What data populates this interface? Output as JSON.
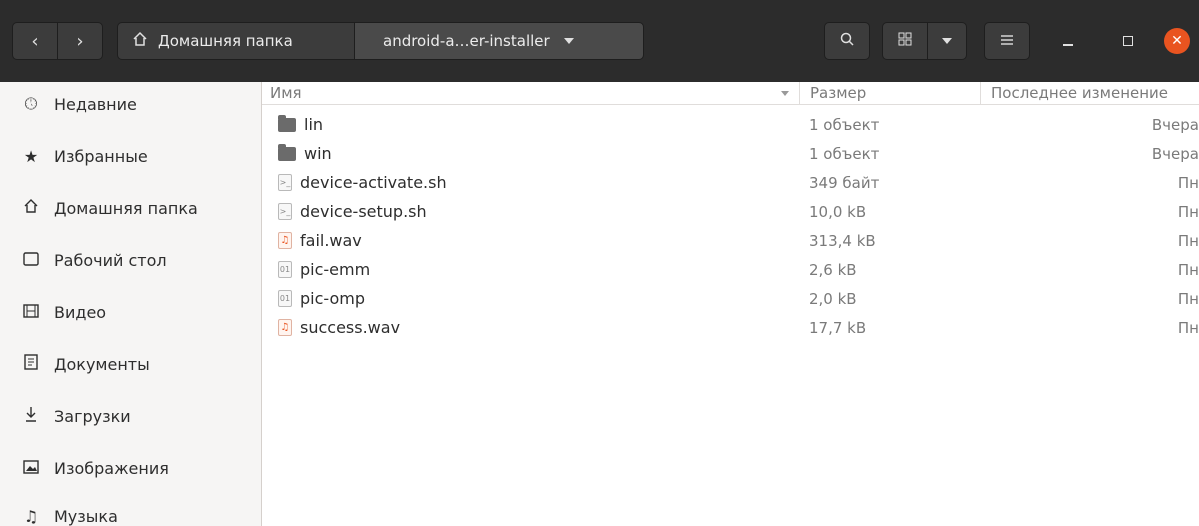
{
  "header": {
    "back_icon": "chevron-left-icon",
    "forward_icon": "chevron-right-icon",
    "home_icon": "home-icon",
    "home_label": "Домашняя папка",
    "current_folder": "android-a…er-installer",
    "search_icon": "search-icon",
    "view_icon": "grid-view-icon",
    "menu_icon": "hamburger-menu-icon",
    "minimize_icon": "minimize-icon",
    "maximize_icon": "maximize-icon",
    "close_icon": "close-icon",
    "close_color": "#e95420"
  },
  "sidebar": {
    "items": [
      {
        "label": "Недавние",
        "icon": "clock-icon"
      },
      {
        "label": "Избранные",
        "icon": "star-icon"
      },
      {
        "label": "Домашняя папка",
        "icon": "home-icon"
      },
      {
        "label": "Рабочий стол",
        "icon": "desktop-icon"
      },
      {
        "label": "Видео",
        "icon": "video-icon"
      },
      {
        "label": "Документы",
        "icon": "document-icon"
      },
      {
        "label": "Загрузки",
        "icon": "download-icon"
      },
      {
        "label": "Изображения",
        "icon": "image-icon"
      },
      {
        "label": "Музыка",
        "icon": "music-icon"
      }
    ]
  },
  "list": {
    "columns": {
      "name": "Имя",
      "size": "Размер",
      "modified": "Последнее изменение"
    },
    "rows": [
      {
        "name": "lin",
        "size": "1 объект",
        "modified": "Вчера",
        "type": "folder"
      },
      {
        "name": "win",
        "size": "1 объект",
        "modified": "Вчера",
        "type": "folder"
      },
      {
        "name": "device-activate.sh",
        "size": "349 байт",
        "modified": "Пн",
        "type": "script"
      },
      {
        "name": "device-setup.sh",
        "size": "10,0 kB",
        "modified": "Пн",
        "type": "script"
      },
      {
        "name": "fail.wav",
        "size": "313,4 kB",
        "modified": "Пн",
        "type": "audio"
      },
      {
        "name": "pic-emm",
        "size": "2,6 kB",
        "modified": "Пн",
        "type": "binary"
      },
      {
        "name": "pic-omp",
        "size": "2,0 kB",
        "modified": "Пн",
        "type": "binary"
      },
      {
        "name": "success.wav",
        "size": "17,7 kB",
        "modified": "Пн",
        "type": "audio"
      }
    ]
  }
}
